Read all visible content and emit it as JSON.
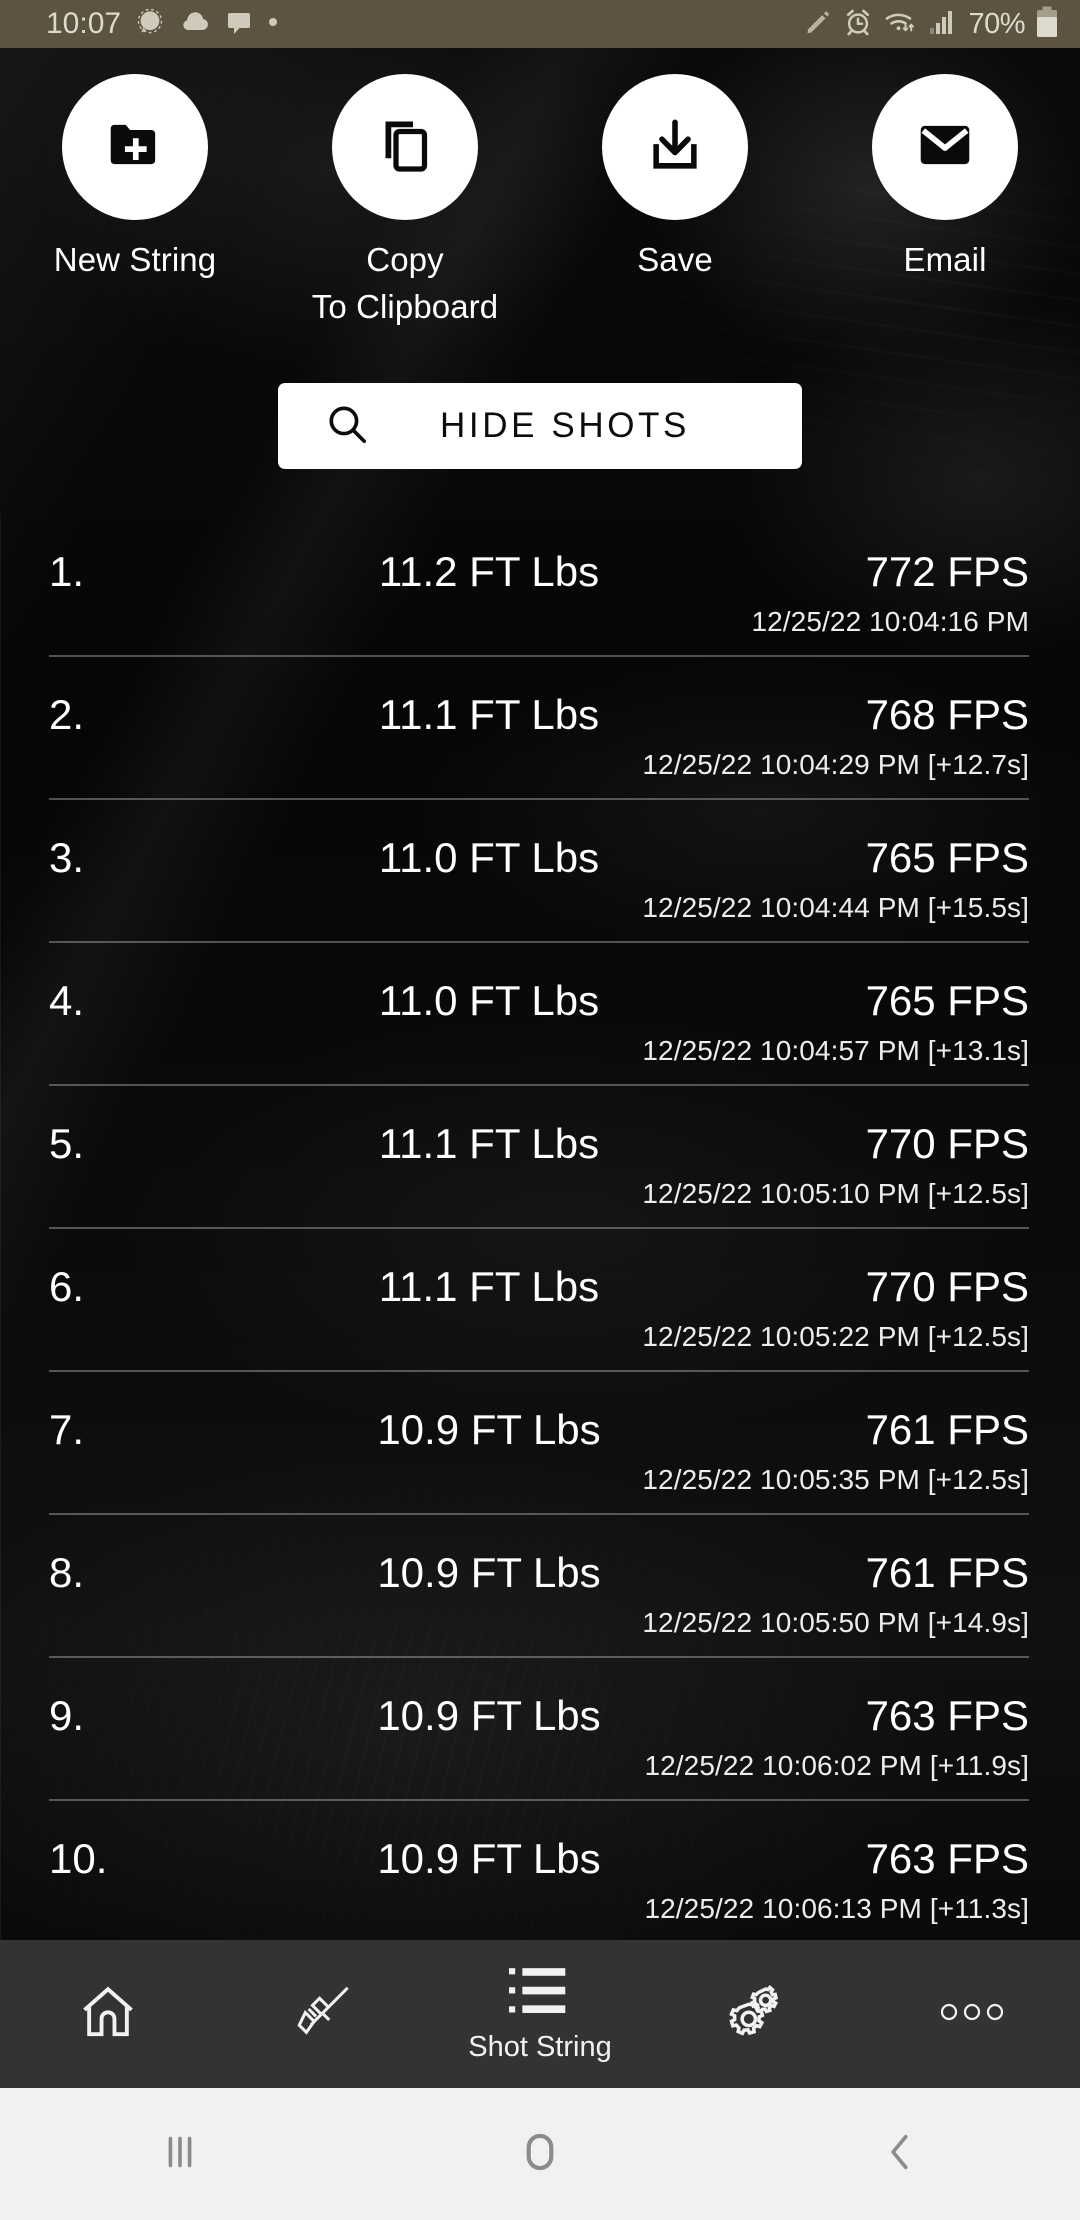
{
  "status_bar": {
    "time": "10:07",
    "battery_percent": "70%",
    "left_icons": [
      "signal-messenger-icon",
      "cloud-icon",
      "message-bubble-icon",
      "dot-icon"
    ],
    "right_icons": [
      "pencil-icon",
      "alarm-clock-icon",
      "wifi-icon",
      "cellular-signal-icon"
    ],
    "background_color": "#5c5440",
    "text_color": "#d6d2c6"
  },
  "actions": [
    {
      "label": "New String",
      "icon": "new-folder-icon"
    },
    {
      "label": "Copy\nTo Clipboard",
      "icon": "copy-icon"
    },
    {
      "label": "Save",
      "icon": "download-icon"
    },
    {
      "label": "Email",
      "icon": "envelope-icon"
    }
  ],
  "hide_shots": {
    "label": "HIDE SHOTS",
    "icon": "search-icon"
  },
  "shots": [
    {
      "index": "1.",
      "energy": "11.2 FT Lbs",
      "velocity": "772 FPS",
      "timestamp": "12/25/22 10:04:16 PM"
    },
    {
      "index": "2.",
      "energy": "11.1 FT Lbs",
      "velocity": "768 FPS",
      "timestamp": "12/25/22 10:04:29 PM [+12.7s]"
    },
    {
      "index": "3.",
      "energy": "11.0 FT Lbs",
      "velocity": "765 FPS",
      "timestamp": "12/25/22 10:04:44 PM [+15.5s]"
    },
    {
      "index": "4.",
      "energy": "11.0 FT Lbs",
      "velocity": "765 FPS",
      "timestamp": "12/25/22 10:04:57 PM [+13.1s]"
    },
    {
      "index": "5.",
      "energy": "11.1 FT Lbs",
      "velocity": "770 FPS",
      "timestamp": "12/25/22 10:05:10 PM [+12.5s]"
    },
    {
      "index": "6.",
      "energy": "11.1 FT Lbs",
      "velocity": "770 FPS",
      "timestamp": "12/25/22 10:05:22 PM [+12.5s]"
    },
    {
      "index": "7.",
      "energy": "10.9 FT Lbs",
      "velocity": "761 FPS",
      "timestamp": "12/25/22 10:05:35 PM [+12.5s]"
    },
    {
      "index": "8.",
      "energy": "10.9 FT Lbs",
      "velocity": "761 FPS",
      "timestamp": "12/25/22 10:05:50 PM [+14.9s]"
    },
    {
      "index": "9.",
      "energy": "10.9 FT Lbs",
      "velocity": "763 FPS",
      "timestamp": "12/25/22 10:06:02 PM [+11.9s]"
    },
    {
      "index": "10.",
      "energy": "10.9 FT Lbs",
      "velocity": "763 FPS",
      "timestamp": "12/25/22 10:06:13 PM [+11.3s]"
    }
  ],
  "tab_bar": {
    "background_color": "#333333",
    "tabs": [
      {
        "icon": "home-icon",
        "label": "",
        "active": false
      },
      {
        "icon": "rifle-icon",
        "label": "",
        "active": false
      },
      {
        "icon": "list-icon",
        "label": "Shot String",
        "active": true
      },
      {
        "icon": "gears-icon",
        "label": "",
        "active": false
      },
      {
        "icon": "more-dots-icon",
        "label": "",
        "active": false
      }
    ]
  },
  "nav_bar": {
    "background_color": "#f1f1f1",
    "buttons": [
      {
        "icon": "recents-icon"
      },
      {
        "icon": "home-circle-icon"
      },
      {
        "icon": "back-icon"
      }
    ]
  }
}
